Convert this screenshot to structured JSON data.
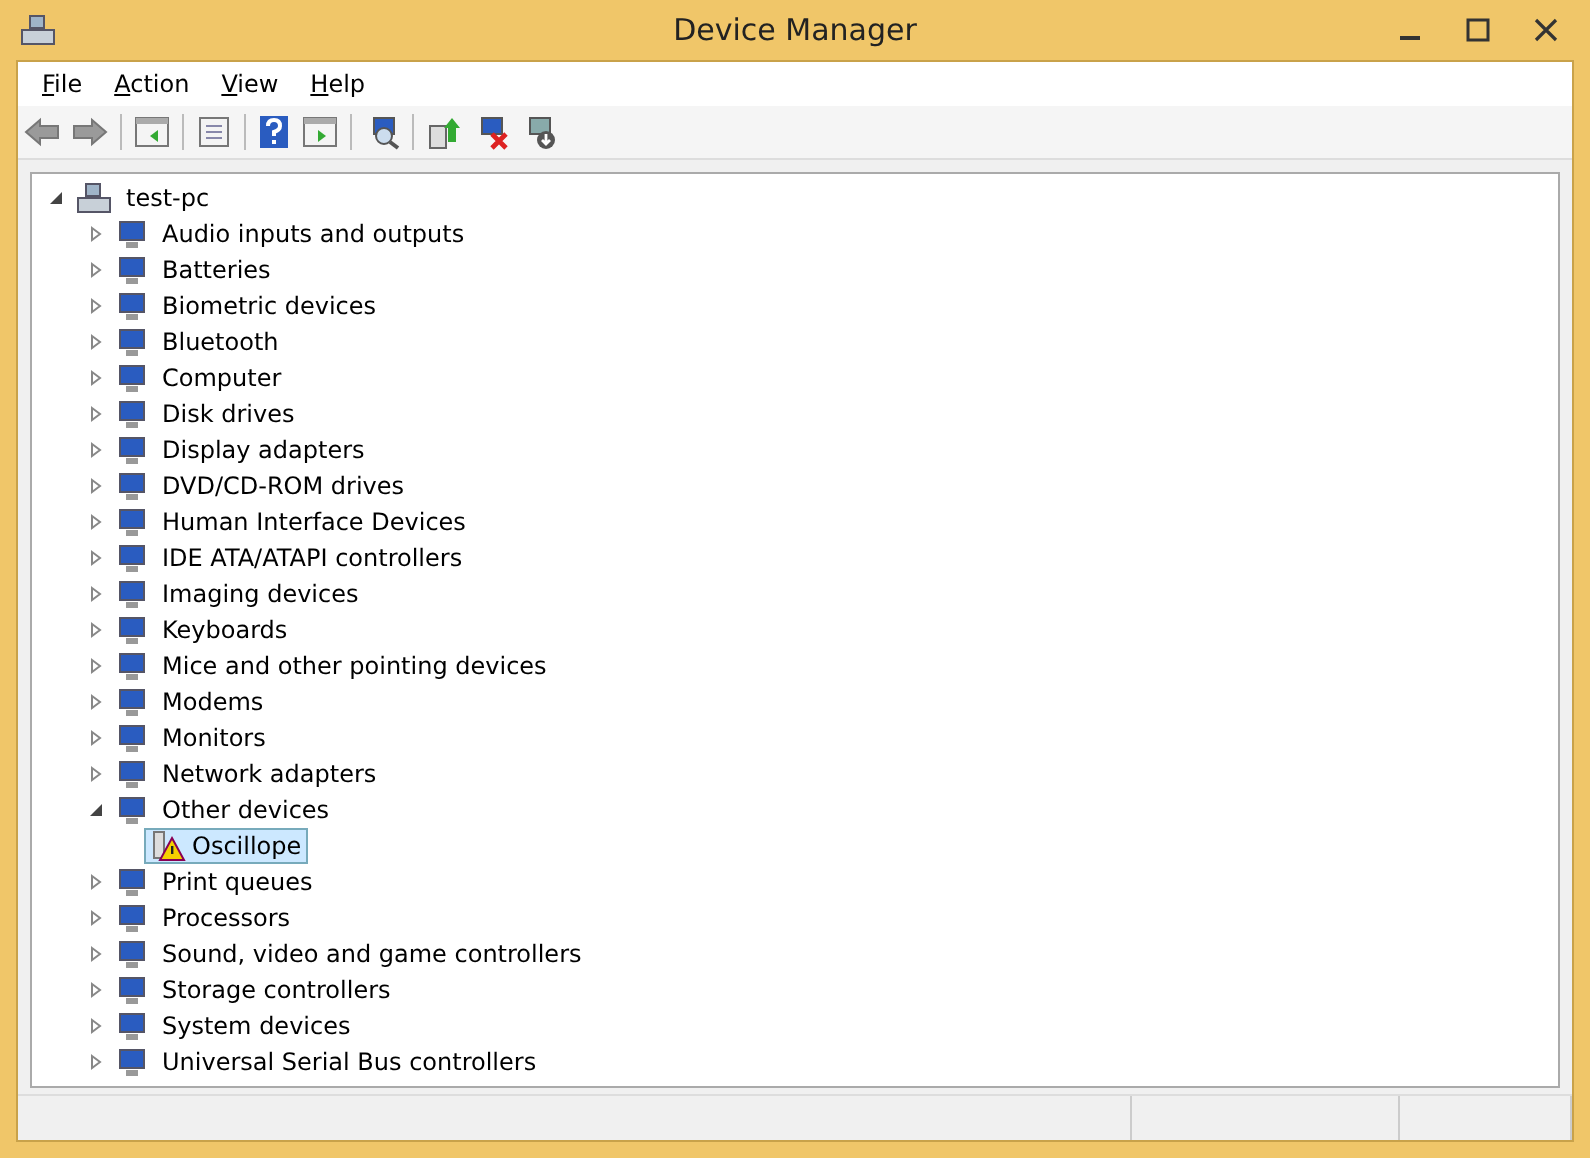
{
  "window": {
    "title": "Device Manager"
  },
  "menu": [
    {
      "label": "File"
    },
    {
      "label": "Action"
    },
    {
      "label": "View"
    },
    {
      "label": "Help"
    }
  ],
  "tree": {
    "label": "test-pc",
    "expanded": true,
    "children": [
      {
        "label": "Audio inputs and outputs",
        "expanded": false,
        "selected": false
      },
      {
        "label": "Batteries",
        "expanded": false,
        "selected": false
      },
      {
        "label": "Biometric devices",
        "expanded": false,
        "selected": false
      },
      {
        "label": "Bluetooth",
        "expanded": false,
        "selected": false
      },
      {
        "label": "Computer",
        "expanded": false,
        "selected": false
      },
      {
        "label": "Disk drives",
        "expanded": false,
        "selected": false
      },
      {
        "label": "Display adapters",
        "expanded": false,
        "selected": false
      },
      {
        "label": "DVD/CD-ROM drives",
        "expanded": false,
        "selected": false
      },
      {
        "label": "Human Interface Devices",
        "expanded": false,
        "selected": false
      },
      {
        "label": "IDE ATA/ATAPI controllers",
        "expanded": false,
        "selected": false
      },
      {
        "label": "Imaging devices",
        "expanded": false,
        "selected": false
      },
      {
        "label": "Keyboards",
        "expanded": false,
        "selected": false
      },
      {
        "label": "Mice and other pointing devices",
        "expanded": false,
        "selected": false
      },
      {
        "label": "Modems",
        "expanded": false,
        "selected": false
      },
      {
        "label": "Monitors",
        "expanded": false,
        "selected": false
      },
      {
        "label": "Network adapters",
        "expanded": false,
        "selected": false
      },
      {
        "label": "Other devices",
        "expanded": true,
        "selected": false,
        "children": [
          {
            "label": "Oscillope",
            "selected": true,
            "warning": true
          }
        ]
      },
      {
        "label": "Print queues",
        "expanded": false,
        "selected": false
      },
      {
        "label": "Processors",
        "expanded": false,
        "selected": false
      },
      {
        "label": "Sound, video and game controllers",
        "expanded": false,
        "selected": false
      },
      {
        "label": "Storage controllers",
        "expanded": false,
        "selected": false
      },
      {
        "label": "System devices",
        "expanded": false,
        "selected": false
      },
      {
        "label": "Universal Serial Bus controllers",
        "expanded": false,
        "selected": false
      }
    ]
  }
}
